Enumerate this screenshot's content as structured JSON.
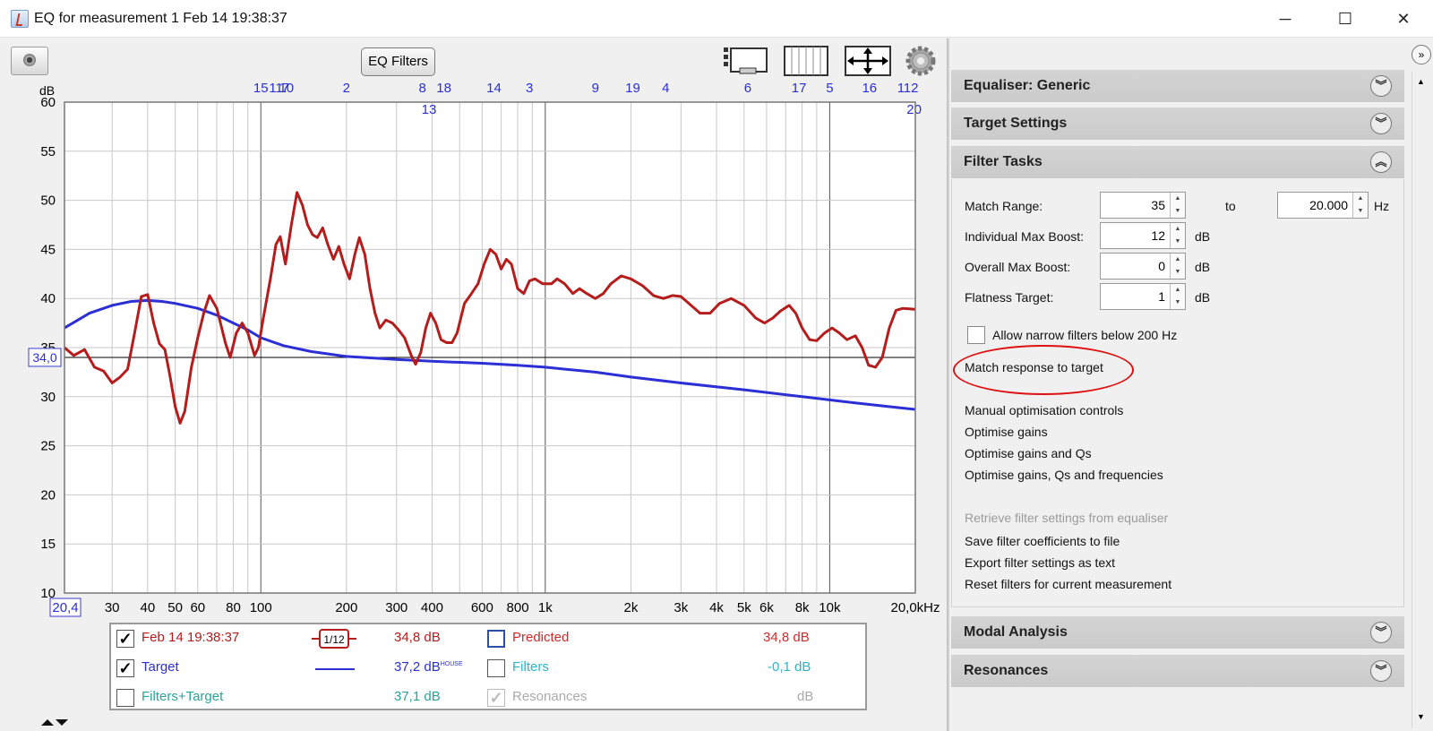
{
  "window": {
    "title": "EQ for measurement 1 Feb 14 19:38:37",
    "min": "─",
    "max": "☐",
    "close": "✕"
  },
  "toolbar": {
    "eq_filters": "EQ Filters"
  },
  "chart_data": {
    "type": "line",
    "ylabel": "dB",
    "xlabel": "Hz",
    "ylim": [
      10,
      60
    ],
    "xlim": [
      20.4,
      20000
    ],
    "x_scale": "log",
    "y_ticks": [
      "60",
      "55",
      "50",
      "45",
      "40",
      "35",
      "30",
      "25",
      "20",
      "15",
      "10"
    ],
    "x_ticks": [
      {
        "f": 30,
        "label": "30"
      },
      {
        "f": 40,
        "label": "40"
      },
      {
        "f": 50,
        "label": "50"
      },
      {
        "f": 60,
        "label": "60"
      },
      {
        "f": 80,
        "label": "80"
      },
      {
        "f": 100,
        "label": "100"
      },
      {
        "f": 200,
        "label": "200"
      },
      {
        "f": 300,
        "label": "300"
      },
      {
        "f": 400,
        "label": "400"
      },
      {
        "f": 600,
        "label": "600"
      },
      {
        "f": 800,
        "label": "800"
      },
      {
        "f": 1000,
        "label": "1k"
      },
      {
        "f": 2000,
        "label": "2k"
      },
      {
        "f": 3000,
        "label": "3k"
      },
      {
        "f": 4000,
        "label": "4k"
      },
      {
        "f": 5000,
        "label": "5k"
      },
      {
        "f": 6000,
        "label": "6k"
      },
      {
        "f": 8000,
        "label": "8k"
      },
      {
        "f": 10000,
        "label": "10k"
      },
      {
        "f": 20000,
        "label": "20,0kHz"
      }
    ],
    "x_start_label": "20,4",
    "cursor_y": 34.0,
    "cursor_label": "34,0",
    "filter_markers": [
      {
        "f": 100,
        "label": "15",
        "row": 0
      },
      {
        "f": 113,
        "label": "11",
        "row": 0
      },
      {
        "f": 123,
        "label": "10",
        "row": 0
      },
      {
        "f": 122,
        "label": "7",
        "row": 0
      },
      {
        "f": 200,
        "label": "2",
        "row": 0
      },
      {
        "f": 370,
        "label": "8",
        "row": 0
      },
      {
        "f": 390,
        "label": "13",
        "row": 1
      },
      {
        "f": 440,
        "label": "18",
        "row": 0
      },
      {
        "f": 660,
        "label": "14",
        "row": 0
      },
      {
        "f": 880,
        "label": "3",
        "row": 0
      },
      {
        "f": 1500,
        "label": "9",
        "row": 0
      },
      {
        "f": 2030,
        "label": "19",
        "row": 0
      },
      {
        "f": 2650,
        "label": "4",
        "row": 0
      },
      {
        "f": 5150,
        "label": "6",
        "row": 0
      },
      {
        "f": 7800,
        "label": "17",
        "row": 0
      },
      {
        "f": 10000,
        "label": "5",
        "row": 0
      },
      {
        "f": 13800,
        "label": "16",
        "row": 0
      },
      {
        "f": 17800,
        "label": "1",
        "row": 0
      },
      {
        "f": 19300,
        "label": "12",
        "row": 0
      },
      {
        "f": 19800,
        "label": "20",
        "row": 1
      }
    ],
    "series": [
      {
        "name": "Feb 14 19:38:37",
        "color": "#b51c1c",
        "points": [
          [
            20.4,
            35.0
          ],
          [
            22,
            34.2
          ],
          [
            24,
            34.8
          ],
          [
            26,
            33.0
          ],
          [
            28,
            32.6
          ],
          [
            30,
            31.4
          ],
          [
            32,
            32.0
          ],
          [
            34,
            32.8
          ],
          [
            36,
            36.5
          ],
          [
            38,
            40.2
          ],
          [
            40,
            40.4
          ],
          [
            42,
            37.5
          ],
          [
            44,
            35.4
          ],
          [
            46,
            34.8
          ],
          [
            48,
            32.0
          ],
          [
            50,
            29.0
          ],
          [
            52,
            27.3
          ],
          [
            54,
            28.5
          ],
          [
            57,
            33.0
          ],
          [
            60,
            36.0
          ],
          [
            63,
            38.5
          ],
          [
            66,
            40.3
          ],
          [
            70,
            39.0
          ],
          [
            75,
            35.5
          ],
          [
            78,
            34.0
          ],
          [
            82,
            36.5
          ],
          [
            86,
            37.5
          ],
          [
            90,
            36.5
          ],
          [
            95,
            34.2
          ],
          [
            98,
            35.0
          ],
          [
            102,
            38.0
          ],
          [
            108,
            42.0
          ],
          [
            113,
            45.5
          ],
          [
            117,
            46.3
          ],
          [
            122,
            43.5
          ],
          [
            128,
            47.5
          ],
          [
            134,
            50.8
          ],
          [
            140,
            49.5
          ],
          [
            146,
            47.5
          ],
          [
            152,
            46.5
          ],
          [
            158,
            46.2
          ],
          [
            165,
            47.2
          ],
          [
            172,
            45.5
          ],
          [
            180,
            44.0
          ],
          [
            188,
            45.3
          ],
          [
            196,
            43.5
          ],
          [
            205,
            42.0
          ],
          [
            214,
            44.5
          ],
          [
            222,
            46.2
          ],
          [
            232,
            44.5
          ],
          [
            242,
            41.0
          ],
          [
            252,
            38.5
          ],
          [
            262,
            37.0
          ],
          [
            275,
            37.8
          ],
          [
            290,
            37.5
          ],
          [
            305,
            36.8
          ],
          [
            320,
            36.0
          ],
          [
            338,
            34.2
          ],
          [
            350,
            33.3
          ],
          [
            365,
            34.5
          ],
          [
            380,
            37.0
          ],
          [
            395,
            38.5
          ],
          [
            412,
            37.5
          ],
          [
            430,
            35.8
          ],
          [
            450,
            35.5
          ],
          [
            470,
            35.5
          ],
          [
            490,
            36.5
          ],
          [
            520,
            39.5
          ],
          [
            550,
            40.5
          ],
          [
            580,
            41.5
          ],
          [
            610,
            43.5
          ],
          [
            640,
            45.0
          ],
          [
            670,
            44.5
          ],
          [
            700,
            43.0
          ],
          [
            730,
            44.0
          ],
          [
            760,
            43.5
          ],
          [
            800,
            41.0
          ],
          [
            840,
            40.5
          ],
          [
            880,
            41.8
          ],
          [
            920,
            42.0
          ],
          [
            980,
            41.5
          ],
          [
            1050,
            41.5
          ],
          [
            1100,
            42.0
          ],
          [
            1170,
            41.5
          ],
          [
            1250,
            40.5
          ],
          [
            1320,
            41.0
          ],
          [
            1400,
            40.5
          ],
          [
            1500,
            40.0
          ],
          [
            1600,
            40.5
          ],
          [
            1700,
            41.5
          ],
          [
            1850,
            42.3
          ],
          [
            2000,
            42.0
          ],
          [
            2200,
            41.3
          ],
          [
            2400,
            40.3
          ],
          [
            2600,
            40.0
          ],
          [
            2800,
            40.3
          ],
          [
            3000,
            40.2
          ],
          [
            3200,
            39.5
          ],
          [
            3500,
            38.5
          ],
          [
            3800,
            38.5
          ],
          [
            4100,
            39.5
          ],
          [
            4500,
            40.0
          ],
          [
            5000,
            39.3
          ],
          [
            5500,
            38.0
          ],
          [
            5900,
            37.5
          ],
          [
            6300,
            38.0
          ],
          [
            6700,
            38.7
          ],
          [
            7200,
            39.3
          ],
          [
            7600,
            38.5
          ],
          [
            8000,
            37.0
          ],
          [
            8500,
            35.8
          ],
          [
            9000,
            35.7
          ],
          [
            9600,
            36.5
          ],
          [
            10200,
            37.0
          ],
          [
            10800,
            36.5
          ],
          [
            11500,
            35.8
          ],
          [
            12300,
            36.2
          ],
          [
            13000,
            35.0
          ],
          [
            13700,
            33.2
          ],
          [
            14500,
            33.0
          ],
          [
            15300,
            34.0
          ],
          [
            16200,
            37.0
          ],
          [
            17100,
            38.8
          ],
          [
            18100,
            39.0
          ],
          [
            20000,
            38.9
          ]
        ]
      },
      {
        "name": "Target",
        "color": "#2b2fd4",
        "points": [
          [
            20.4,
            37.0
          ],
          [
            25,
            38.5
          ],
          [
            30,
            39.3
          ],
          [
            35,
            39.7
          ],
          [
            40,
            39.8
          ],
          [
            45,
            39.7
          ],
          [
            50,
            39.5
          ],
          [
            60,
            39.0
          ],
          [
            70,
            38.3
          ],
          [
            80,
            37.5
          ],
          [
            90,
            36.8
          ],
          [
            100,
            36.0
          ],
          [
            120,
            35.2
          ],
          [
            150,
            34.6
          ],
          [
            200,
            34.1
          ],
          [
            300,
            33.8
          ],
          [
            400,
            33.6
          ],
          [
            600,
            33.4
          ],
          [
            800,
            33.2
          ],
          [
            1000,
            33.0
          ],
          [
            1500,
            32.5
          ],
          [
            2000,
            32.0
          ],
          [
            3000,
            31.4
          ],
          [
            5000,
            30.7
          ],
          [
            8000,
            30.0
          ],
          [
            12000,
            29.4
          ],
          [
            16000,
            29.0
          ],
          [
            20000,
            28.7
          ]
        ]
      }
    ]
  },
  "legend": {
    "rows": [
      {
        "checked": "✓",
        "name": "Feb 14 19:38:37",
        "smooth": "1/12",
        "value": "34,8 dB",
        "r_checked": "",
        "r_name": "Predicted",
        "r_value": "34,8 dB"
      },
      {
        "checked": "✓",
        "name": "Target",
        "value": "37,2 dB",
        "sup": "HOUSE",
        "r_checked": "",
        "r_name": "Filters",
        "r_value": "-0,1 dB"
      },
      {
        "checked": "",
        "name": "Filters+Target",
        "value": "37,1 dB",
        "r_checked": "✓",
        "r_name": "Resonances",
        "r_value": "dB"
      }
    ]
  },
  "sections": {
    "equaliser": "Equaliser: Generic",
    "target": "Target Settings",
    "filter_tasks": "Filter Tasks",
    "modal": "Modal Analysis",
    "resonances": "Resonances"
  },
  "filter_tasks": {
    "match_range_label": "Match Range:",
    "match_from": "35",
    "to": "to",
    "match_to": "20.000",
    "hz": "Hz",
    "ind_boost_label": "Individual Max Boost:",
    "ind_boost": "12",
    "overall_boost_label": "Overall Max Boost:",
    "overall_boost": "0",
    "flatness_label": "Flatness Target:",
    "flatness": "1",
    "db": "dB",
    "narrow_label": "Allow narrow filters below 200 Hz",
    "match_response": "Match response to target",
    "manual": "Manual optimisation controls",
    "opt_gains": "Optimise gains",
    "opt_gains_qs": "Optimise gains and Qs",
    "opt_all": "Optimise gains, Qs and frequencies",
    "retrieve": "Retrieve filter settings from equaliser",
    "save_coef": "Save filter coefficients to file",
    "export": "Export filter settings as text",
    "reset": "Reset filters for current measurement"
  }
}
